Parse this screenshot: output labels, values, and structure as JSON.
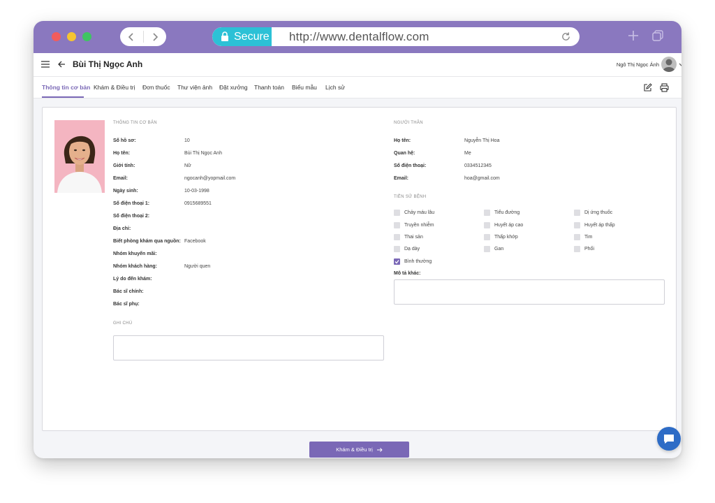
{
  "browser": {
    "secure_label": "Secure",
    "url": "http://www.dentalflow.com"
  },
  "header": {
    "patient_name": "Bùi Thị Ngọc Anh",
    "user_name": "Ngô Thị Ngọc Ánh"
  },
  "tabs": [
    {
      "label": "Thông tin cơ bản",
      "active": true
    },
    {
      "label": "Khám & Điều trị"
    },
    {
      "label": "Đơn thuốc"
    },
    {
      "label": "Thư viện ảnh"
    },
    {
      "label": "Đặt xưởng"
    },
    {
      "label": "Thanh toán"
    },
    {
      "label": "Biểu mẫu"
    },
    {
      "label": "Lịch sử"
    }
  ],
  "basic_info": {
    "title": "THÔNG TIN CƠ BẢN",
    "fields": [
      {
        "label": "Số hồ sơ:",
        "value": "10"
      },
      {
        "label": "Họ tên:",
        "value": "Bùi Thị Ngọc Anh"
      },
      {
        "label": "Giới tính:",
        "value": "Nữ"
      },
      {
        "label": "Email:",
        "value": "ngocanh@yopmail.com"
      },
      {
        "label": "Ngày sinh:",
        "value": "10-03-1998"
      },
      {
        "label": "Số điện thoại 1:",
        "value": "0915689551"
      },
      {
        "label": "Số điện thoại 2:",
        "value": ""
      },
      {
        "label": "Địa chỉ:",
        "value": ""
      },
      {
        "label": "Biết phòng khám qua nguồn:",
        "value": "Facebook"
      },
      {
        "label": "Nhóm khuyến mãi:",
        "value": ""
      },
      {
        "label": "Nhóm khách hàng:",
        "value": "Người quen"
      },
      {
        "label": "Lý do đến khám:",
        "value": ""
      },
      {
        "label": "Bác sĩ chính:",
        "value": ""
      },
      {
        "label": "Bác sĩ phụ:",
        "value": ""
      }
    ],
    "notes_title": "GHI CHÚ",
    "notes_value": ""
  },
  "relative": {
    "title": "NGƯỜI THÂN",
    "fields": [
      {
        "label": "Họ tên:",
        "value": "Nguyễn Thị Hoa"
      },
      {
        "label": "Quan hệ:",
        "value": "Mẹ"
      },
      {
        "label": "Số điện thoại:",
        "value": "0334512345"
      },
      {
        "label": "Email:",
        "value": "hoa@gmail.com"
      }
    ]
  },
  "medical_history": {
    "title": "TIỀN SỬ BỆNH",
    "conditions": [
      {
        "label": "Chảy máu lâu",
        "checked": false
      },
      {
        "label": "Tiểu đường",
        "checked": false
      },
      {
        "label": "Dị ứng thuốc",
        "checked": false
      },
      {
        "label": "Truyền nhiễm",
        "checked": false
      },
      {
        "label": "Huyết áp cao",
        "checked": false
      },
      {
        "label": "Huyết áp thấp",
        "checked": false
      },
      {
        "label": "Thai sản",
        "checked": false
      },
      {
        "label": "Thấp khớp",
        "checked": false
      },
      {
        "label": "Tim",
        "checked": false
      },
      {
        "label": "Dạ dày",
        "checked": false
      },
      {
        "label": "Gan",
        "checked": false
      },
      {
        "label": "Phổi",
        "checked": false
      },
      {
        "label": "Bình thường",
        "checked": true
      }
    ],
    "other_label": "Mô tả khác:",
    "other_value": ""
  },
  "footer": {
    "primary_button": "Khám & Điều trị"
  },
  "colors": {
    "titlebar": "#8a78bf",
    "accent": "#7a68b6",
    "secure_badge": "#2cc1d6",
    "chat_button": "#2e6cc6"
  },
  "icons": {
    "window_controls": [
      "close-dot",
      "minimize-dot",
      "maximize-dot"
    ],
    "browser": [
      "chevron-left-icon",
      "chevron-right-icon",
      "lock-icon",
      "reload-icon",
      "plus-icon",
      "tabs-icon"
    ],
    "app": [
      "menu-icon",
      "arrow-left-icon",
      "edit-icon",
      "print-icon",
      "arrow-right-icon",
      "chat-icon"
    ]
  }
}
